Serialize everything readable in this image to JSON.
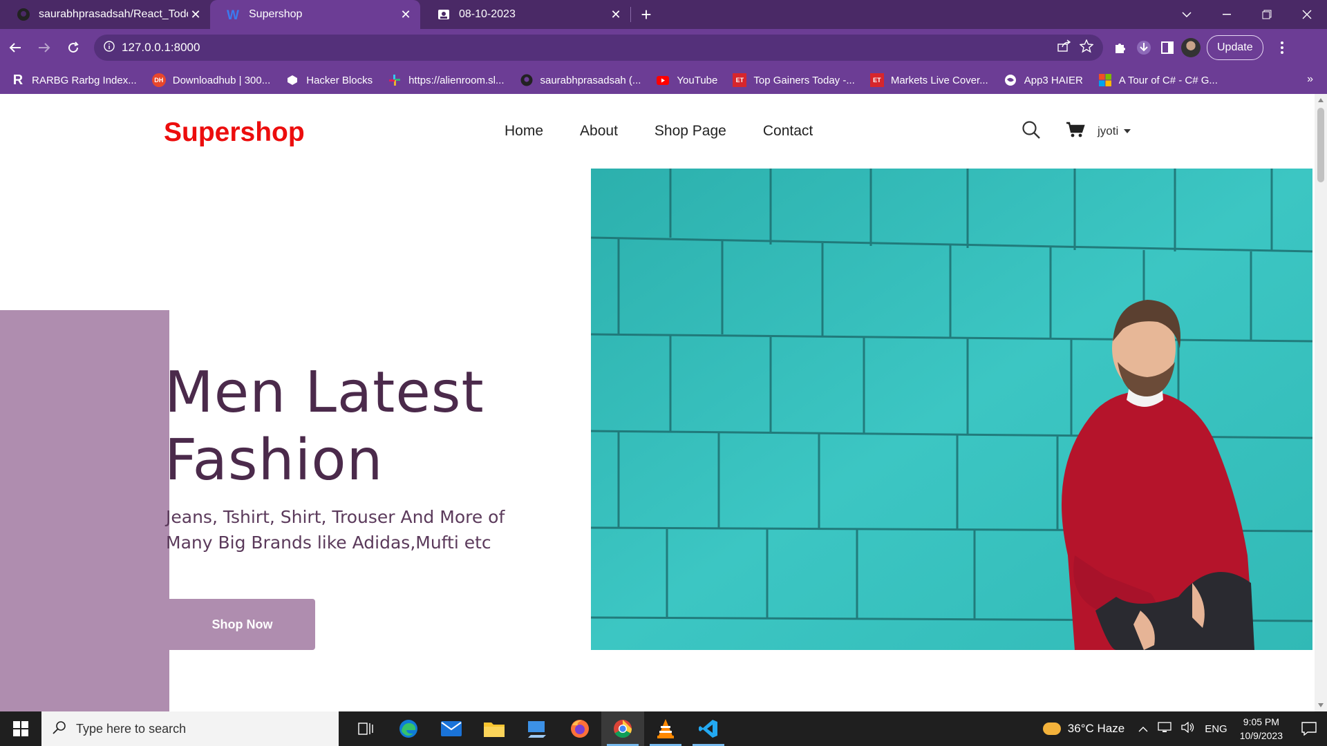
{
  "browser": {
    "tabs": [
      {
        "title": "saurabhprasadsah/React_Todo-/",
        "icon": "github-icon",
        "active": false
      },
      {
        "title": "Supershop",
        "icon": "w-logo-icon",
        "active": true
      },
      {
        "title": "08-10-2023",
        "icon": "contact-card-icon",
        "active": false
      }
    ],
    "url": "127.0.0.1:8000",
    "update_label": "Update",
    "bookmarks": [
      {
        "label": "RARBG Rarbg Index...",
        "icon": "rarbg-icon"
      },
      {
        "label": "Downloadhub | 300...",
        "icon": "downloadhub-icon"
      },
      {
        "label": "Hacker Blocks",
        "icon": "hackerblocks-icon"
      },
      {
        "label": "https://alienroom.sl...",
        "icon": "slack-icon"
      },
      {
        "label": "saurabhprasadsah (...",
        "icon": "github-icon"
      },
      {
        "label": "YouTube",
        "icon": "youtube-icon"
      },
      {
        "label": "Top Gainers Today -...",
        "icon": "et-icon"
      },
      {
        "label": "Markets Live Cover...",
        "icon": "et-icon"
      },
      {
        "label": "App3 HAIER",
        "icon": "globe-icon"
      },
      {
        "label": "A Tour of C# - C# G...",
        "icon": "microsoft-icon"
      }
    ],
    "bookmarks_more": "»"
  },
  "site": {
    "logo": "Supershop",
    "nav": [
      "Home",
      "About",
      "Shop Page",
      "Contact"
    ],
    "user": "jyoti"
  },
  "hero": {
    "title_line1": "Men Latest",
    "title_line2": "Fashion",
    "subtitle": "Jeans, Tshirt, Shirt, Trouser And More of Many Big Brands like Adidas,Mufti etc",
    "button": "Shop Now",
    "accent_color": "#af8daf",
    "title_color": "#4b2a4b",
    "logo_color": "#ec0d0d"
  },
  "taskbar": {
    "search_placeholder": "Type here to search",
    "weather": "36°C  Haze",
    "language": "ENG",
    "time": "9:05 PM",
    "date": "10/9/2023"
  }
}
